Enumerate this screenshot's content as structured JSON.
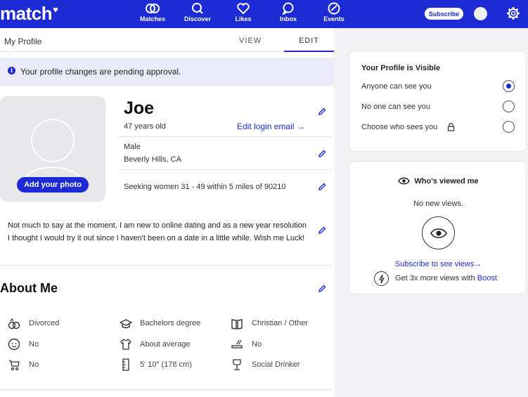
{
  "brand": {
    "logo_text": "match",
    "color": "#1c2bd4"
  },
  "nav": {
    "items": [
      {
        "label": "Matches",
        "icon": "matches-icon"
      },
      {
        "label": "Discover",
        "icon": "search-icon"
      },
      {
        "label": "Likes",
        "icon": "heart-icon"
      },
      {
        "label": "Inbox",
        "icon": "chat-bubble-icon"
      },
      {
        "label": "Events",
        "icon": "ticket-icon"
      }
    ],
    "subscribe_label": "Subscribe"
  },
  "tabs": {
    "page_label": "My Profile",
    "view_label": "VIEW",
    "edit_label": "EDIT",
    "active": "EDIT"
  },
  "banner": {
    "text": "Your profile changes are pending approval."
  },
  "profile": {
    "add_photo_label": "Add your photo",
    "name": "Joe",
    "age": "47 years old",
    "edit_email_label": "Edit login email →",
    "gender": "Male",
    "location": "Beverly Hills, CA",
    "seeking": "Seeking women 31 - 49 within 5 miles of 90210",
    "bio": "Not much to say at the moment. I am new to online dating and as a new year resolution I thought I would try it out since I haven't been on a date in a little while. Wish me Luck!"
  },
  "about": {
    "title": "About Me",
    "attributes": [
      {
        "label": "Divorced",
        "icon": "rings-icon"
      },
      {
        "label": "Bachelors degree",
        "icon": "graduation-cap-icon"
      },
      {
        "label": "Christian / Other",
        "icon": "book-icon"
      },
      {
        "label": "No",
        "icon": "baby-face-icon"
      },
      {
        "label": "About average",
        "icon": "shirt-icon"
      },
      {
        "label": "No",
        "icon": "smoking-icon"
      },
      {
        "label": "No",
        "icon": "stroller-icon"
      },
      {
        "label": "5' 10\" (178 cm)",
        "icon": "ruler-icon"
      },
      {
        "label": "Social Drinker",
        "icon": "wine-glass-icon"
      }
    ]
  },
  "visibility": {
    "title": "Your Profile is Visible",
    "options": [
      {
        "label": "Anyone can see you",
        "selected": true
      },
      {
        "label": "No one can see you",
        "selected": false
      },
      {
        "label": "Choose who sees you",
        "selected": false,
        "icon": "lock-icon"
      }
    ]
  },
  "viewed": {
    "title": "Who's viewed me",
    "status": "No new views.",
    "subscribe_link": "Subscribe to see views→",
    "boost_text": "Get 3x more views with ",
    "boost_link": "Boost"
  }
}
